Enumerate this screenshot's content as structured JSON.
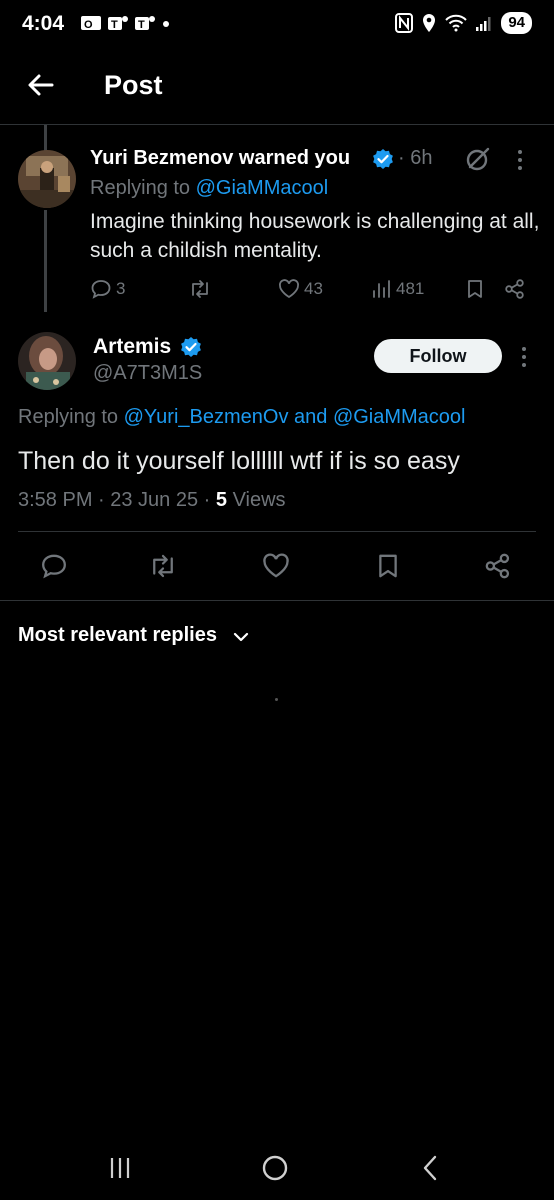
{
  "status_bar": {
    "time": "4:04",
    "battery": "94"
  },
  "header": {
    "title": "Post"
  },
  "parent_tweet": {
    "name": "Yuri Bezmenov warned you",
    "time": "· 6h",
    "replying_prefix": "Replying to ",
    "replying_handle": "@GiaMMacool",
    "text": "Imagine thinking housework is challenging at all, such a childish mentality.",
    "replies": "3",
    "likes": "43",
    "views": "481"
  },
  "main_tweet": {
    "name": "Artemis",
    "handle": "@A7T3M1S",
    "follow_label": "Follow",
    "replying_prefix": "Replying to ",
    "replying_handle1": "@Yuri_BezmenOv",
    "replying_and": " and ",
    "replying_handle2": "@GiaMMacool",
    "text": "Then do it yourself lollllll wtf if is so easy",
    "timestamp": "3:58 PM · 23 Jun 25 · ",
    "views_count": "5",
    "views_label": " Views"
  },
  "replies_sort": {
    "label": "Most relevant replies"
  },
  "colors": {
    "accent": "#1d9bf0",
    "muted": "#71767b",
    "background": "#000000"
  }
}
